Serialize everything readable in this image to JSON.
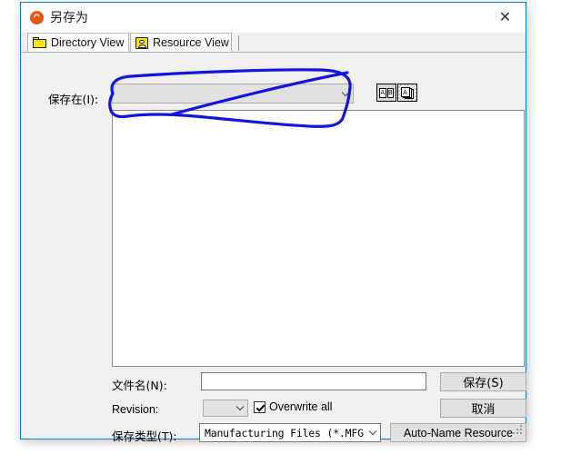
{
  "window": {
    "title": "另存为",
    "app_icon": "creo-orb-icon",
    "close_label": "✕",
    "border_color": "#0a7ad6"
  },
  "tabs": [
    {
      "label": "Directory View",
      "icon": "folder-icon",
      "active": false
    },
    {
      "label": "Resource View",
      "icon": "resource-face-icon",
      "active": true
    }
  ],
  "toolbar": {
    "save_in_label": "保存在(I):",
    "save_in_value": "",
    "buttons": [
      {
        "name": "list-view-button",
        "icon": "ab-boxes-icon",
        "glyph_a": "A",
        "glyph_b": "B",
        "pressed": false
      },
      {
        "name": "detail-view-button",
        "icon": "stacked-pages-icon",
        "glyph": "A",
        "pressed": true
      }
    ]
  },
  "file_list": {
    "items": [],
    "empty": true
  },
  "form": {
    "file_name_label": "文件名(N):",
    "file_name_value": "",
    "file_name_placeholder": "",
    "revision_label": "Revision:",
    "revision_value": "",
    "overwrite_label": "Overwrite all",
    "overwrite_checked": true,
    "file_type_label": "保存类型(T):",
    "file_type_value": "Manufacturing Files (*.MFG)"
  },
  "buttons": {
    "save": "保存(S)",
    "cancel": "取消",
    "auto_name": "Auto-Name Resource"
  },
  "annotation": {
    "color": "#1414e0",
    "shape": "hand-drawn-ellipse-with-slash",
    "target": "save-in-dropdown"
  }
}
